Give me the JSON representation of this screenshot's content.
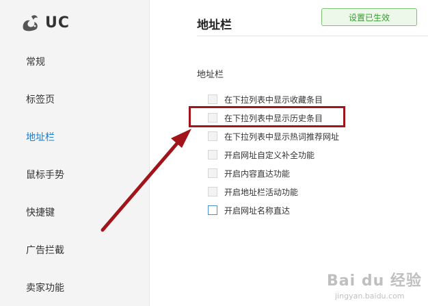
{
  "app": {
    "logo_text": "UC"
  },
  "sidebar": {
    "items": [
      {
        "label": "常规",
        "active": false
      },
      {
        "label": "标签页",
        "active": false
      },
      {
        "label": "地址栏",
        "active": true
      },
      {
        "label": "鼠标手势",
        "active": false
      },
      {
        "label": "快捷键",
        "active": false
      },
      {
        "label": "广告拦截",
        "active": false
      },
      {
        "label": "卖家功能",
        "active": false
      }
    ]
  },
  "main": {
    "title": "地址栏",
    "applied_button": "设置已生效",
    "section_title": "地址栏",
    "options": [
      {
        "label": "在下拉列表中显示收藏条目",
        "checked": false
      },
      {
        "label": "在下拉列表中显示历史条目",
        "checked": false
      },
      {
        "label": "在下拉列表中显示热词推荐网址",
        "checked": false
      },
      {
        "label": "开启网址自定义补全功能",
        "checked": false
      },
      {
        "label": "开启内容直达功能",
        "checked": false
      },
      {
        "label": "开启地址栏活动功能",
        "checked": false
      },
      {
        "label": "开启网址名称直达",
        "checked": false
      }
    ]
  },
  "annotation": {
    "color": "#a0141a",
    "highlighted_option": "在下拉列表中显示历史条目"
  },
  "watermark": {
    "main": "Bai du 经验",
    "sub": "jingyan.baidu.com"
  },
  "colors": {
    "accent": "#1a7bd0",
    "applied_green": "#3a9a33",
    "sidebar_bg": "#f4f4f4"
  }
}
